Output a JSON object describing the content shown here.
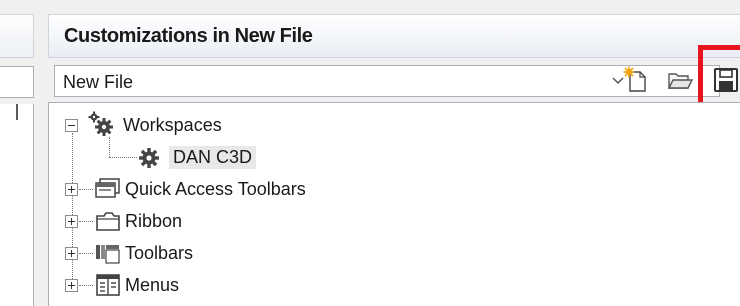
{
  "panel": {
    "title": "Customizations in New File"
  },
  "file_selector": {
    "value": "New File"
  },
  "tree": {
    "items": [
      {
        "label": "Workspaces"
      },
      {
        "label": "DAN C3D"
      },
      {
        "label": "Quick Access Toolbars"
      },
      {
        "label": "Ribbon"
      },
      {
        "label": "Toolbars"
      },
      {
        "label": "Menus"
      }
    ]
  },
  "colors": {
    "highlight": "#e8161c",
    "header_bg": "#e9edf4",
    "tree_bg": "#ffffff"
  },
  "icons": [
    "new-file-icon",
    "open-file-icon",
    "save-icon",
    "gear-cluster-icon",
    "gear-icon",
    "toolbar-icon",
    "ribbon-icon",
    "toolbars-icon",
    "menus-icon"
  ]
}
